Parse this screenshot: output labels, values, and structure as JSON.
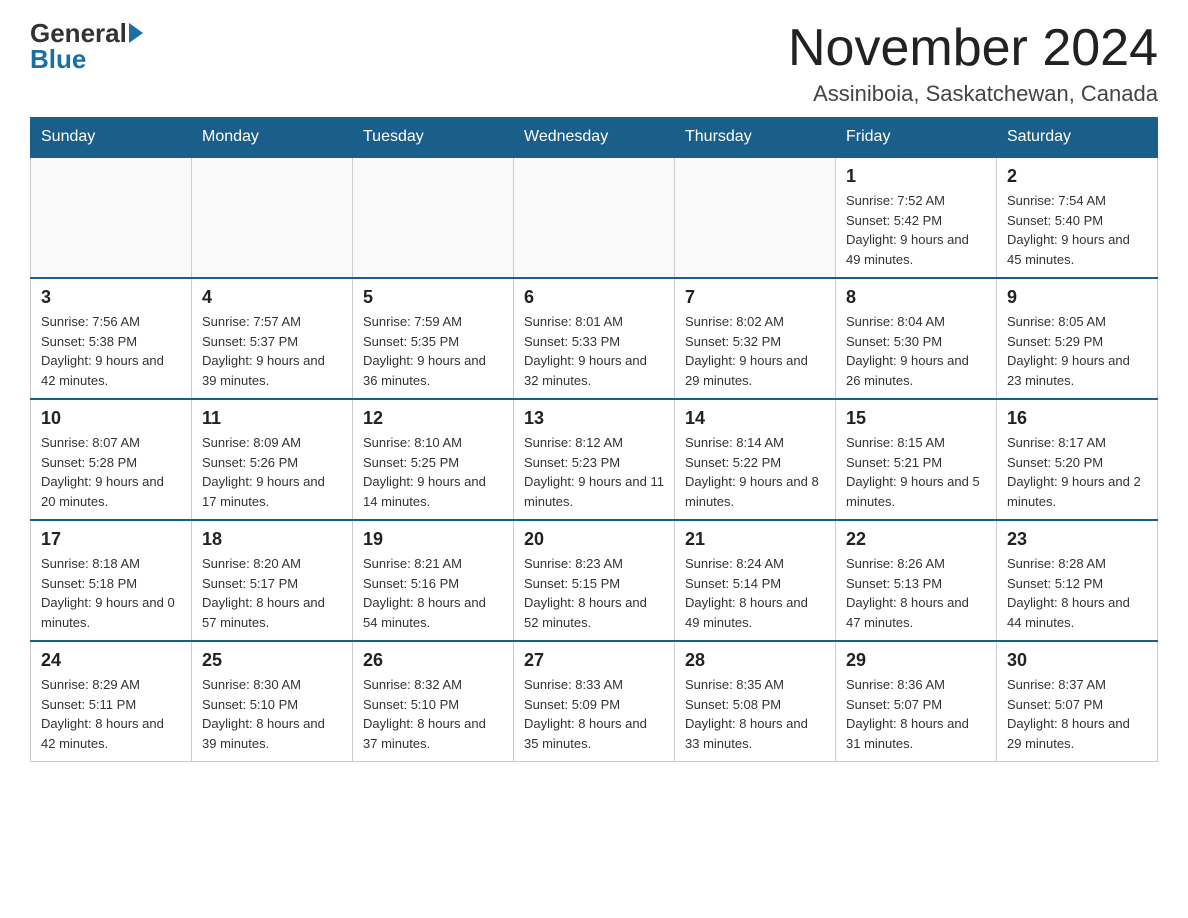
{
  "logo": {
    "general": "General",
    "blue": "Blue"
  },
  "title": "November 2024",
  "location": "Assiniboia, Saskatchewan, Canada",
  "days_of_week": [
    "Sunday",
    "Monday",
    "Tuesday",
    "Wednesday",
    "Thursday",
    "Friday",
    "Saturday"
  ],
  "weeks": [
    [
      {
        "day": "",
        "info": ""
      },
      {
        "day": "",
        "info": ""
      },
      {
        "day": "",
        "info": ""
      },
      {
        "day": "",
        "info": ""
      },
      {
        "day": "",
        "info": ""
      },
      {
        "day": "1",
        "info": "Sunrise: 7:52 AM\nSunset: 5:42 PM\nDaylight: 9 hours and 49 minutes."
      },
      {
        "day": "2",
        "info": "Sunrise: 7:54 AM\nSunset: 5:40 PM\nDaylight: 9 hours and 45 minutes."
      }
    ],
    [
      {
        "day": "3",
        "info": "Sunrise: 7:56 AM\nSunset: 5:38 PM\nDaylight: 9 hours and 42 minutes."
      },
      {
        "day": "4",
        "info": "Sunrise: 7:57 AM\nSunset: 5:37 PM\nDaylight: 9 hours and 39 minutes."
      },
      {
        "day": "5",
        "info": "Sunrise: 7:59 AM\nSunset: 5:35 PM\nDaylight: 9 hours and 36 minutes."
      },
      {
        "day": "6",
        "info": "Sunrise: 8:01 AM\nSunset: 5:33 PM\nDaylight: 9 hours and 32 minutes."
      },
      {
        "day": "7",
        "info": "Sunrise: 8:02 AM\nSunset: 5:32 PM\nDaylight: 9 hours and 29 minutes."
      },
      {
        "day": "8",
        "info": "Sunrise: 8:04 AM\nSunset: 5:30 PM\nDaylight: 9 hours and 26 minutes."
      },
      {
        "day": "9",
        "info": "Sunrise: 8:05 AM\nSunset: 5:29 PM\nDaylight: 9 hours and 23 minutes."
      }
    ],
    [
      {
        "day": "10",
        "info": "Sunrise: 8:07 AM\nSunset: 5:28 PM\nDaylight: 9 hours and 20 minutes."
      },
      {
        "day": "11",
        "info": "Sunrise: 8:09 AM\nSunset: 5:26 PM\nDaylight: 9 hours and 17 minutes."
      },
      {
        "day": "12",
        "info": "Sunrise: 8:10 AM\nSunset: 5:25 PM\nDaylight: 9 hours and 14 minutes."
      },
      {
        "day": "13",
        "info": "Sunrise: 8:12 AM\nSunset: 5:23 PM\nDaylight: 9 hours and 11 minutes."
      },
      {
        "day": "14",
        "info": "Sunrise: 8:14 AM\nSunset: 5:22 PM\nDaylight: 9 hours and 8 minutes."
      },
      {
        "day": "15",
        "info": "Sunrise: 8:15 AM\nSunset: 5:21 PM\nDaylight: 9 hours and 5 minutes."
      },
      {
        "day": "16",
        "info": "Sunrise: 8:17 AM\nSunset: 5:20 PM\nDaylight: 9 hours and 2 minutes."
      }
    ],
    [
      {
        "day": "17",
        "info": "Sunrise: 8:18 AM\nSunset: 5:18 PM\nDaylight: 9 hours and 0 minutes."
      },
      {
        "day": "18",
        "info": "Sunrise: 8:20 AM\nSunset: 5:17 PM\nDaylight: 8 hours and 57 minutes."
      },
      {
        "day": "19",
        "info": "Sunrise: 8:21 AM\nSunset: 5:16 PM\nDaylight: 8 hours and 54 minutes."
      },
      {
        "day": "20",
        "info": "Sunrise: 8:23 AM\nSunset: 5:15 PM\nDaylight: 8 hours and 52 minutes."
      },
      {
        "day": "21",
        "info": "Sunrise: 8:24 AM\nSunset: 5:14 PM\nDaylight: 8 hours and 49 minutes."
      },
      {
        "day": "22",
        "info": "Sunrise: 8:26 AM\nSunset: 5:13 PM\nDaylight: 8 hours and 47 minutes."
      },
      {
        "day": "23",
        "info": "Sunrise: 8:28 AM\nSunset: 5:12 PM\nDaylight: 8 hours and 44 minutes."
      }
    ],
    [
      {
        "day": "24",
        "info": "Sunrise: 8:29 AM\nSunset: 5:11 PM\nDaylight: 8 hours and 42 minutes."
      },
      {
        "day": "25",
        "info": "Sunrise: 8:30 AM\nSunset: 5:10 PM\nDaylight: 8 hours and 39 minutes."
      },
      {
        "day": "26",
        "info": "Sunrise: 8:32 AM\nSunset: 5:10 PM\nDaylight: 8 hours and 37 minutes."
      },
      {
        "day": "27",
        "info": "Sunrise: 8:33 AM\nSunset: 5:09 PM\nDaylight: 8 hours and 35 minutes."
      },
      {
        "day": "28",
        "info": "Sunrise: 8:35 AM\nSunset: 5:08 PM\nDaylight: 8 hours and 33 minutes."
      },
      {
        "day": "29",
        "info": "Sunrise: 8:36 AM\nSunset: 5:07 PM\nDaylight: 8 hours and 31 minutes."
      },
      {
        "day": "30",
        "info": "Sunrise: 8:37 AM\nSunset: 5:07 PM\nDaylight: 8 hours and 29 minutes."
      }
    ]
  ]
}
